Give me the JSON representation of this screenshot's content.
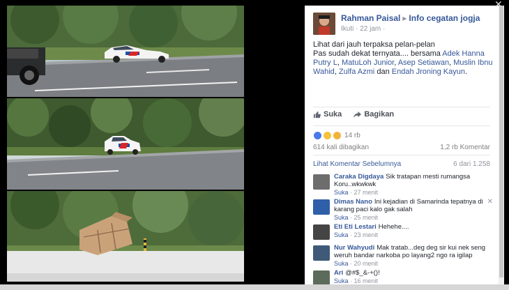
{
  "close_glyph": "✕",
  "post": {
    "author": "Rahman Paisal",
    "group": "Info cegatan jogja",
    "time": "Ikuti · 22 jam ·",
    "text_line1": "Lihat dari jauh terpaksa pelan-pelan",
    "text_line2": "Pas sudah dekat ternyata....",
    "with_label": "bersama",
    "tag1": "Adek Hanna Putry L",
    "tag2": "MatuLoh Junior",
    "tag3": "Asep Setiawan",
    "tag4": "Muslin Ibnu Wahid",
    "tag5": "Zulfa Azmi",
    "and_label": "dan",
    "tag6": "Endah Jroning Kayun"
  },
  "actions": {
    "like": "Suka",
    "share": "Bagikan"
  },
  "reactions": {
    "count": "14 rb"
  },
  "stats": {
    "shares": "614 kali dibagikan",
    "comments": "1,2 rb Komentar"
  },
  "comments_header": {
    "prev_label": "Lihat Komentar Sebelumnya",
    "count": "6 dari 1.258"
  },
  "comments": [
    {
      "name": "Caraka Digdaya",
      "text": "Sik tratapan mesti rumangsa Koru..wkwkwk",
      "like": "Suka",
      "time": "27 menit"
    },
    {
      "name": "Dimas Nano",
      "text": "Ini kejadian di Samarinda tepatnya di karang paci kalo gak salah",
      "like": "Suka",
      "time": "25 menit"
    },
    {
      "name": "Eti Eti Lestari",
      "text": "Hehehe....",
      "like": "Suka",
      "time": "23 menit"
    },
    {
      "name": "Nur Wahyudi",
      "text": "Mak tratab...deg deg sir kui nek seng weruh bandar narkoba po layang2 ngo ra igilap",
      "like": "Suka",
      "time": "20 menit"
    },
    {
      "name": "Ari",
      "text": "@#$_&-+()!",
      "like": "Suka",
      "time": "16 menit"
    }
  ]
}
